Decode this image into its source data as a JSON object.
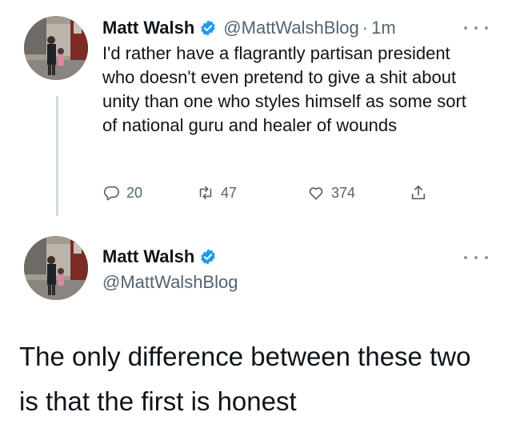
{
  "tweet1": {
    "display_name": "Matt Walsh",
    "handle": "@MattWalshBlog",
    "separator": "·",
    "time": "1m",
    "text": "I'd rather have a flagrantly partisan president who doesn't even pretend to give a shit about unity than one who styles himself as some sort of national guru and healer of wounds",
    "actions": {
      "reply_count": "20",
      "retweet_count": "47",
      "like_count": "374"
    }
  },
  "tweet2": {
    "display_name": "Matt Walsh",
    "handle": "@MattWalshBlog",
    "text": "The only difference between these two is that the first is honest"
  },
  "colors": {
    "verified": "#1d9bf0",
    "secondary_text": "#536471",
    "thread_line": "#cfd9de"
  },
  "icons": [
    "verified-badge-icon",
    "more-options-icon",
    "reply-icon",
    "retweet-icon",
    "like-icon",
    "share-icon"
  ]
}
